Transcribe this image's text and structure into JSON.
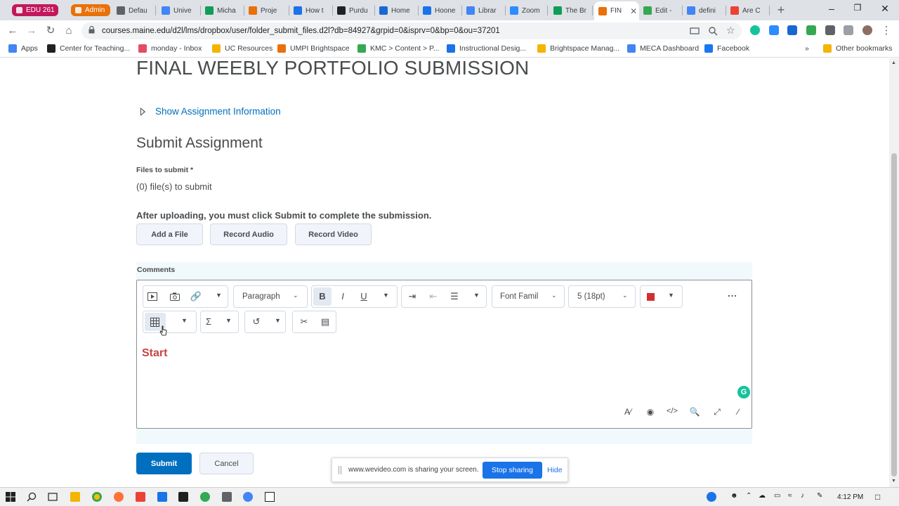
{
  "browser": {
    "tabs": [
      {
        "label": "EDU 261",
        "color": "#c2185b",
        "group": true
      },
      {
        "label": "Admin",
        "color": "#e8710a",
        "group": true
      },
      {
        "label": "Defau",
        "color": "#5f6368"
      },
      {
        "label": "Unive",
        "color": "#4285f4"
      },
      {
        "label": "Micha",
        "color": "#0f9d58"
      },
      {
        "label": "Proje",
        "color": "#e8710a"
      },
      {
        "label": "How t",
        "color": "#1a73e8"
      },
      {
        "label": "Purdu",
        "color": "#202124"
      },
      {
        "label": "Home",
        "color": "#1967d2"
      },
      {
        "label": "Hoone",
        "color": "#1a73e8"
      },
      {
        "label": "Librar",
        "color": "#4285f4"
      },
      {
        "label": "Zoom",
        "color": "#2d8cff"
      },
      {
        "label": "The Br",
        "color": "#0f9d58"
      },
      {
        "label": "FIN",
        "color": "#e8710a",
        "active": true
      },
      {
        "label": "Edit -",
        "color": "#34a853"
      },
      {
        "label": "defini",
        "color": "#4285f4"
      },
      {
        "label": "Are C",
        "color": "#ea4335"
      }
    ],
    "url": "courses.maine.edu/d2l/lms/dropbox/user/folder_submit_files.d2l?db=84927&grpid=0&isprv=0&bp=0&ou=37201",
    "bookmarks": [
      {
        "label": "Apps",
        "color": "#4285f4"
      },
      {
        "label": "Center for Teaching...",
        "color": "#202124"
      },
      {
        "label": "monday - Inbox",
        "color": "#e44c65"
      },
      {
        "label": "UC Resources",
        "color": "#f4b400"
      },
      {
        "label": "UMPI Brightspace",
        "color": "#e8710a"
      },
      {
        "label": "KMC > Content > P...",
        "color": "#34a853"
      },
      {
        "label": "Instructional Desig...",
        "color": "#1a73e8"
      },
      {
        "label": "Brightspace Manag...",
        "color": "#f4b400"
      },
      {
        "label": "MECA Dashboard",
        "color": "#4285f4"
      },
      {
        "label": "Facebook",
        "color": "#1877f2"
      },
      {
        "label": "Other bookmarks",
        "color": "#f4b400"
      }
    ],
    "bookmarks_more": "»"
  },
  "page": {
    "title": "FINAL WEEBLY PORTFOLIO SUBMISSION",
    "show_info": "Show Assignment Information",
    "section_heading": "Submit Assignment",
    "files_label": "Files to submit *",
    "files_count": "(0) file(s) to submit",
    "after_note": "After uploading, you must click Submit to complete the submission.",
    "buttons": {
      "add_file": "Add a File",
      "record_audio": "Record Audio",
      "record_video": "Record Video",
      "submit": "Submit",
      "cancel": "Cancel"
    },
    "comments_label": "Comments",
    "editor": {
      "paragraph": "Paragraph",
      "font_family": "Font Famil",
      "font_size": "5 (18pt)",
      "text_color": "#d32f2f",
      "content": "Start",
      "more": "..."
    }
  },
  "share_bar": {
    "message": "www.wevideo.com is sharing your screen.",
    "stop": "Stop sharing",
    "hide": "Hide"
  },
  "taskbar": {
    "time": "4:12 PM"
  },
  "colors": {
    "link": "#006fbf",
    "primary_button": "#006fbf",
    "start_text": "#c74343"
  }
}
